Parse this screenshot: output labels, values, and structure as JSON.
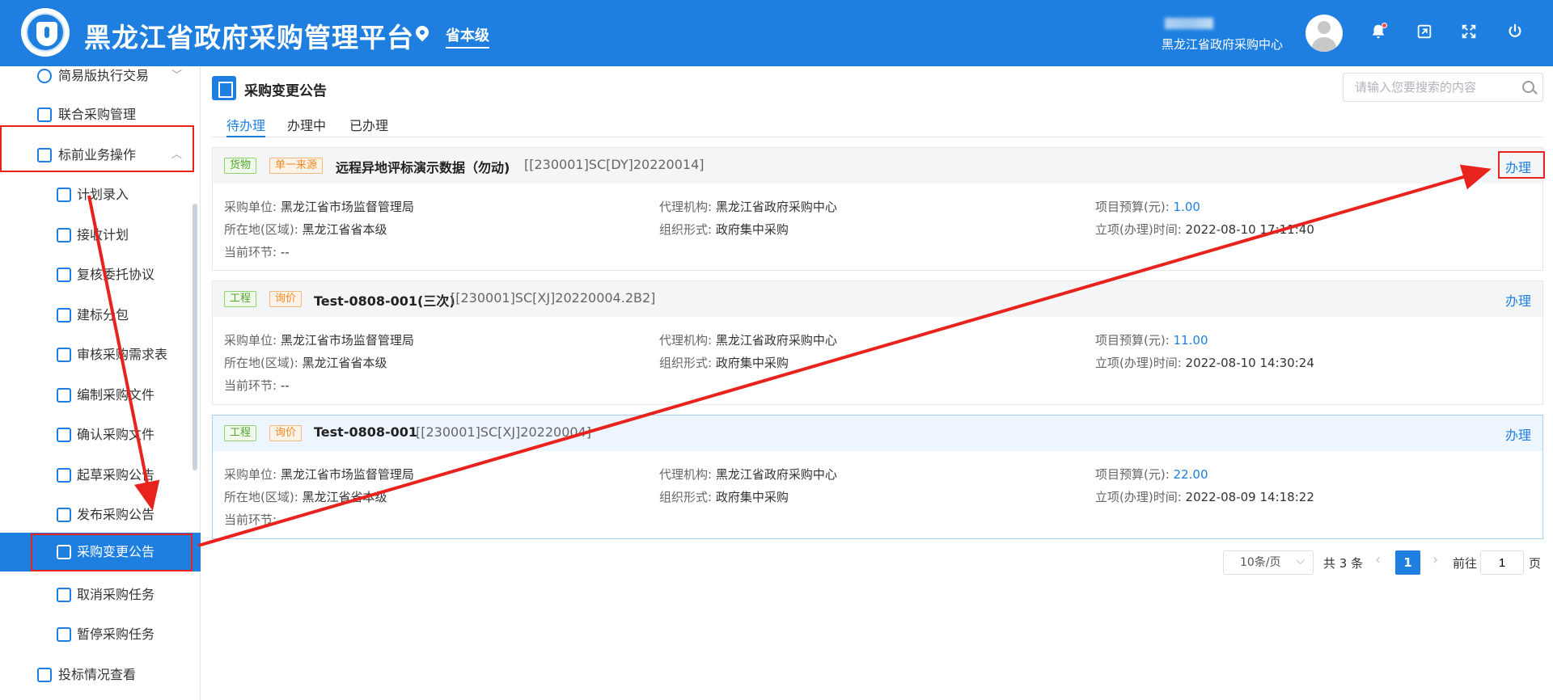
{
  "header": {
    "title": "黑龙江省政府采购管理平台",
    "region": "省本级",
    "org_name": "黑龙江省政府采购中心",
    "icons": [
      "bell-icon",
      "window-icon",
      "fullscreen-icon",
      "power-icon"
    ]
  },
  "sidebar": {
    "items": [
      {
        "label": "简易版执行交易",
        "icon": "simple-trade-icon"
      },
      {
        "label": "联合采购管理",
        "icon": "joint-purchase-icon"
      },
      {
        "label": "标前业务操作",
        "icon": "cart-icon"
      },
      {
        "label": "计划录入",
        "icon": "check-doc-icon"
      },
      {
        "label": "接收计划",
        "icon": "import-icon"
      },
      {
        "label": "复核委托协议",
        "icon": "doc-icon"
      },
      {
        "label": "建标分包",
        "icon": "edit-doc-icon"
      },
      {
        "label": "审核采购需求表",
        "icon": "clipboard-icon"
      },
      {
        "label": "编制采购文件",
        "icon": "file-icon"
      },
      {
        "label": "确认采购文件",
        "icon": "file-check-icon"
      },
      {
        "label": "起草采购公告",
        "icon": "cart-edit-icon"
      },
      {
        "label": "发布采购公告",
        "icon": "publish-icon"
      },
      {
        "label": "采购变更公告",
        "icon": "change-notice-icon"
      },
      {
        "label": "取消采购任务",
        "icon": "cancel-task-icon"
      },
      {
        "label": "暂停采购任务",
        "icon": "pause-task-icon"
      },
      {
        "label": "投标情况查看",
        "icon": "bid-view-icon"
      }
    ]
  },
  "page": {
    "title": "采购变更公告",
    "search_placeholder": "请输入您要搜索的内容"
  },
  "tabs": [
    "待办理",
    "办理中",
    "已办理"
  ],
  "labels": {
    "unit": "采购单位:",
    "location": "所在地(区域):",
    "stage": "当前环节:",
    "agency": "代理机构:",
    "form": "组织形式:",
    "budget": "项目预算(元):",
    "time": "立项(办理)时间:",
    "action": "办理"
  },
  "records": [
    {
      "tag1": "货物",
      "tag2": "单一来源",
      "name": "远程异地评标演示数据（勿动)",
      "code": "[[230001]SC[DY]20220014]",
      "unit": "黑龙江省市场监督管理局",
      "location": "黑龙江省省本级",
      "stage": "--",
      "agency": "黑龙江省政府采购中心",
      "form": "政府集中采购",
      "budget": "1.00",
      "time": "2022-08-10 17:11:40"
    },
    {
      "tag1": "工程",
      "tag2": "询价",
      "name": "Test-0808-001(三次)",
      "code": "[[230001]SC[XJ]20220004.2B2]",
      "unit": "黑龙江省市场监督管理局",
      "location": "黑龙江省省本级",
      "stage": "--",
      "agency": "黑龙江省政府采购中心",
      "form": "政府集中采购",
      "budget": "11.00",
      "time": "2022-08-10 14:30:24"
    },
    {
      "tag1": "工程",
      "tag2": "询价",
      "name": "Test-0808-001",
      "code": "[[230001]SC[XJ]20220004]",
      "unit": "黑龙江省市场监督管理局",
      "location": "黑龙江省省本级",
      "stage": "--",
      "agency": "黑龙江省政府采购中心",
      "form": "政府集中采购",
      "budget": "22.00",
      "time": "2022-08-09 14:18:22"
    }
  ],
  "pagination": {
    "page_size": "10条/页",
    "total": "共 3 条",
    "current": "1",
    "goto_label": "前往",
    "goto_value": "1",
    "page_label": "页"
  },
  "colors": {
    "brand": "#1e7fe0",
    "annotation": "#e8231e",
    "tag_green": "#52a82d",
    "tag_orange": "#f08a24"
  }
}
